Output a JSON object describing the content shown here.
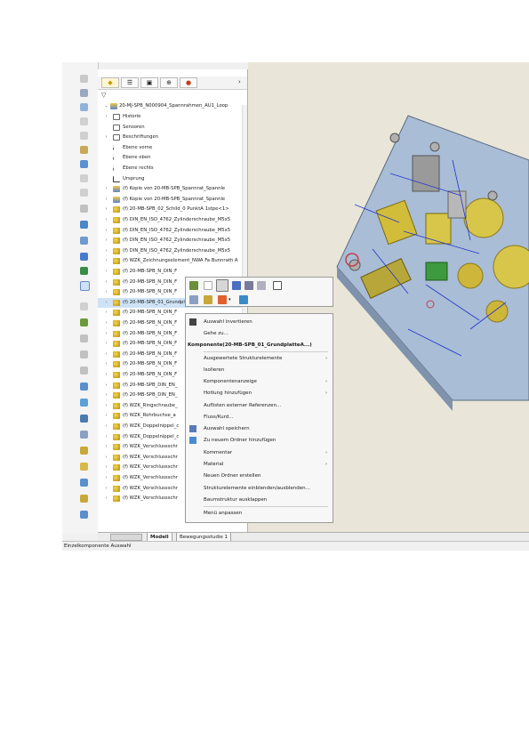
{
  "tree": {
    "root_label": "20-MJ-SPB_N000904_Spannrahmen_AU1_Loop",
    "rows": [
      {
        "label": "Historie",
        "icon": "history-icon",
        "type": "doc",
        "exp": "›"
      },
      {
        "label": "Sensoren",
        "icon": "sensor-icon",
        "type": "doc",
        "exp": ""
      },
      {
        "label": "Beschriftungen",
        "icon": "annotations-icon",
        "type": "doc",
        "exp": "›"
      },
      {
        "label": "Ebene vorne",
        "icon": "plane-icon",
        "type": "plane",
        "exp": ""
      },
      {
        "label": "Ebene oben",
        "icon": "plane-icon",
        "type": "plane",
        "exp": ""
      },
      {
        "label": "Ebene rechts",
        "icon": "plane-icon",
        "type": "plane",
        "exp": ""
      },
      {
        "label": "Ursprung",
        "icon": "origin-icon",
        "type": "origin",
        "exp": ""
      },
      {
        "label": "(f) Kopie von 20-MB-SPB_Spannrat_Spannle",
        "icon": "assembly-icon",
        "type": "asm",
        "exp": "›"
      },
      {
        "label": "(f) Kopie von 20-MB-SPB_Spannrat_Spannle",
        "icon": "assembly-icon",
        "type": "asm",
        "exp": "›"
      },
      {
        "label": "(f) 20-MB-SPB_02_Schild_0 PunktA 1stpe<1>",
        "icon": "part-icon",
        "type": "part",
        "exp": "›"
      },
      {
        "label": "(f) DIN_EN_ISO_4762_Zylinderschraube_M5x5",
        "icon": "part-icon",
        "type": "part",
        "exp": "›"
      },
      {
        "label": "(f) DIN_EN_ISO_4762_Zylinderschraube_M5x5",
        "icon": "part-icon",
        "type": "part",
        "exp": "›"
      },
      {
        "label": "(f) DIN_EN_ISO_4762_Zylinderschraube_M5x5",
        "icon": "part-icon",
        "type": "part",
        "exp": "›"
      },
      {
        "label": "(f) DIN_EN_ISO_4762_Zylinderschraube_M5x5",
        "icon": "part-icon",
        "type": "part",
        "exp": "›"
      },
      {
        "label": "(f) WZK_Zeichnungselement_NWA Fa Bunnrath A",
        "icon": "part-icon",
        "type": "part",
        "exp": "›"
      },
      {
        "label": "(f) 20-MB-SPB_N_DIN_F",
        "icon": "part-icon",
        "type": "part",
        "exp": "›"
      },
      {
        "label": "(f) 20-MB-SPB_N_DIN_F",
        "icon": "part-icon",
        "type": "part",
        "exp": "›"
      },
      {
        "label": "(f) 20-MB-SPB_N_DIN_F",
        "icon": "part-icon",
        "type": "part",
        "exp": "›"
      },
      {
        "label": "(f) 20-MB-SPB_01_Grundplatte<1> -> (S.)",
        "icon": "part-icon",
        "type": "part",
        "exp": "›",
        "selected": true
      },
      {
        "label": "(f) 20-MB-SPB_N_DIN_F",
        "icon": "part-icon",
        "type": "part",
        "exp": "›"
      },
      {
        "label": "(f) 20-MB-SPB_N_DIN_F",
        "icon": "part-icon",
        "type": "part",
        "exp": "›"
      },
      {
        "label": "(f) 20-MB-SPB_N_DIN_F",
        "icon": "part-icon",
        "type": "part",
        "exp": "›"
      },
      {
        "label": "(f) 20-MB-SPB_N_DIN_F",
        "icon": "part-icon",
        "type": "part",
        "exp": "›"
      },
      {
        "label": "(f) 20-MB-SPB_N_DIN_F",
        "icon": "part-icon",
        "type": "part",
        "exp": "›"
      },
      {
        "label": "(f) 20-MB-SPB_N_DIN_F",
        "icon": "part-icon",
        "type": "part",
        "exp": "›"
      },
      {
        "label": "(f) 20-MB-SPB_N_DIN_F",
        "icon": "part-icon",
        "type": "part",
        "exp": "›"
      },
      {
        "label": "(f) 20-MB-SPB_DIN_EN_",
        "icon": "part-icon",
        "type": "part",
        "exp": "›"
      },
      {
        "label": "(f) 20-MB-SPB_DIN_EN_",
        "icon": "part-icon",
        "type": "part",
        "exp": "›"
      },
      {
        "label": "(f) WZK_Ringschraube_",
        "icon": "part-icon",
        "type": "part",
        "exp": "›"
      },
      {
        "label": "(f) WZK_Rohrbuchse_a",
        "icon": "part-icon",
        "type": "part",
        "exp": "›"
      },
      {
        "label": "(f) WZK_Doppelnippel_c",
        "icon": "part-icon",
        "type": "part",
        "exp": "›"
      },
      {
        "label": "(f) WZK_Doppelnippel_c",
        "icon": "part-icon",
        "type": "part",
        "exp": "›"
      },
      {
        "label": "(f) WZK_Verschlussschr",
        "icon": "part-icon",
        "type": "part",
        "exp": "›"
      },
      {
        "label": "(f) WZK_Verschlussschr",
        "icon": "part-icon",
        "type": "part",
        "exp": "›"
      },
      {
        "label": "(f) WZK_Verschlussschr",
        "icon": "part-icon",
        "type": "part",
        "exp": "›"
      },
      {
        "label": "(f) WZK_Verschlussschr",
        "icon": "part-icon",
        "type": "part",
        "exp": "›"
      },
      {
        "label": "(f) WZK_Verschlussschr",
        "icon": "part-icon",
        "type": "part",
        "exp": "›"
      },
      {
        "label": "(f) WZK_Verschlussschr",
        "icon": "part-icon",
        "type": "part",
        "exp": "›"
      }
    ]
  },
  "tree_tabs": [
    {
      "icon": "feature-manager-icon"
    },
    {
      "icon": "property-manager-icon"
    },
    {
      "icon": "configuration-manager-icon"
    },
    {
      "icon": "dimxpert-icon"
    },
    {
      "icon": "display-manager-icon"
    }
  ],
  "context_menu": {
    "title": "Komponente(20-MB-SPB_01_GrundplatteA...)",
    "items": [
      {
        "label": "Auswahl invertieren",
        "icon": "invert-selection-icon",
        "submenu": false
      },
      {
        "label": "Gehe zu...",
        "icon": "",
        "submenu": false
      },
      {
        "label": "Ausgewertete Strukturelemente",
        "icon": "",
        "submenu": true
      },
      {
        "label": "Isolieren",
        "icon": "",
        "submenu": false
      },
      {
        "label": "Komponentenanzeige",
        "icon": "",
        "submenu": true
      },
      {
        "label": "Hotlung hinzufügen",
        "icon": "",
        "submenu": true
      },
      {
        "label": "Auflisten externer Referenzen...",
        "icon": "",
        "submenu": false
      },
      {
        "label": "Fluss/Kurd...",
        "icon": "",
        "submenu": false
      },
      {
        "label": "Auswahl speichern",
        "icon": "save-selection-icon",
        "submenu": false
      },
      {
        "label": "Zu neuem Ordner hinzufügen",
        "icon": "folder-icon",
        "submenu": false
      },
      {
        "label": "Kommentar",
        "icon": "",
        "submenu": true
      },
      {
        "label": "Material",
        "icon": "",
        "submenu": true
      },
      {
        "label": "Neuen Ordner erstellen",
        "icon": "",
        "submenu": false
      },
      {
        "label": "Strukturelemente einblenden/ausblenden...",
        "icon": "",
        "submenu": false
      },
      {
        "label": "Baumstruktur ausklappen",
        "icon": "",
        "submenu": false
      },
      {
        "label": "Menü anpassen",
        "icon": "",
        "submenu": false
      }
    ]
  },
  "bottom_tabs": {
    "model": "Modell",
    "motion": "Bewegungsstudie 1"
  },
  "status_bar": {
    "text": "Einzelkomponente Auswahl"
  },
  "colors": {
    "viewport_bg": "#e9e6d9",
    "plate": "#a9bdd6",
    "yellow_parts": "#d8c64a",
    "dimension_lines": "#2233cc",
    "selection": "#cfe3f7"
  }
}
